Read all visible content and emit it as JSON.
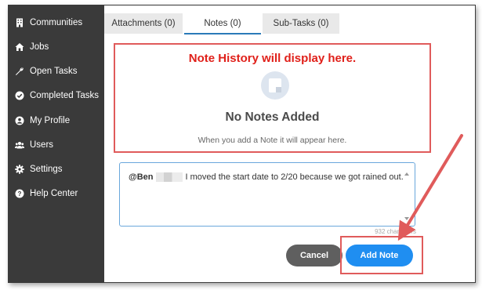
{
  "sidebar": {
    "items": [
      {
        "label": "Communities",
        "icon": "building-icon"
      },
      {
        "label": "Jobs",
        "icon": "home-icon"
      },
      {
        "label": "Open Tasks",
        "icon": "wrench-icon"
      },
      {
        "label": "Completed Tasks",
        "icon": "check-circle-icon"
      },
      {
        "label": "My Profile",
        "icon": "user-circle-icon"
      },
      {
        "label": "Users",
        "icon": "users-icon"
      },
      {
        "label": "Settings",
        "icon": "gear-icon"
      },
      {
        "label": "Help Center",
        "icon": "question-circle-icon"
      }
    ]
  },
  "tabs": {
    "attachments": "Attachments (0)",
    "notes": "Notes (0)",
    "subtasks": "Sub-Tasks (0)"
  },
  "history": {
    "annotation": "Note History will display here.",
    "empty_title": "No Notes Added",
    "empty_subtitle": "When you add a Note it will appear here."
  },
  "note_input": {
    "mention": "@Ben",
    "text": "I moved the start date to 2/20 because we got rained out.",
    "char_count": "932 characters"
  },
  "buttons": {
    "cancel": "Cancel",
    "add_note": "Add Note"
  },
  "colors": {
    "sidebar_bg": "#3a3a3a",
    "accent_blue": "#1f8ef1",
    "annotation_red": "#e05b5b",
    "cancel_gray": "#5f5f5f"
  }
}
